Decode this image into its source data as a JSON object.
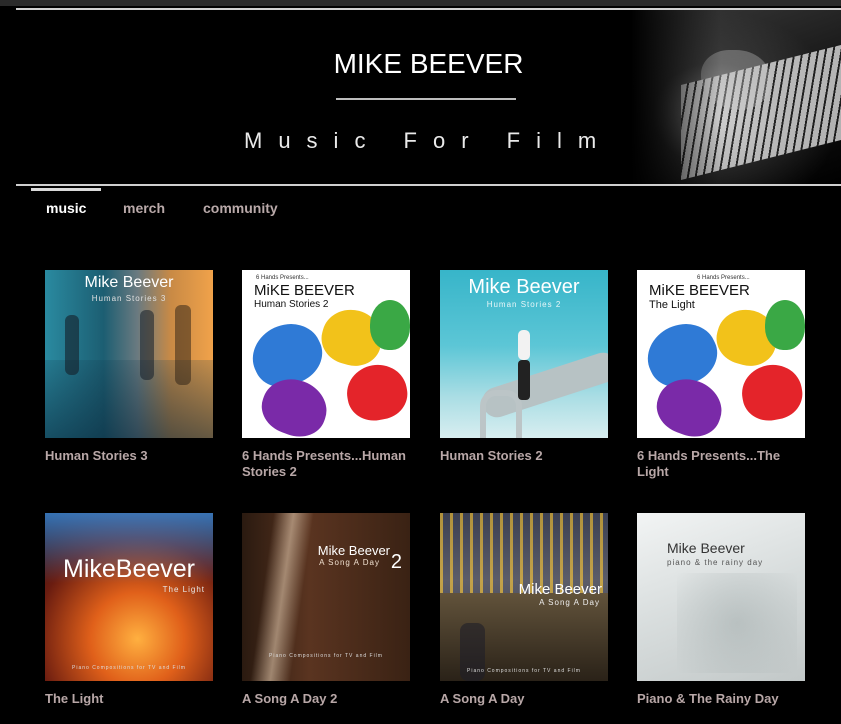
{
  "header": {
    "title": "MIKE BEEVER",
    "subtitle": "Music For Film"
  },
  "nav": {
    "tabs": [
      {
        "label": "music",
        "active": true
      },
      {
        "label": "merch",
        "active": false
      },
      {
        "label": "community",
        "active": false
      }
    ]
  },
  "albums": [
    {
      "title": "Human Stories 3",
      "cover": {
        "artist": "Mike Beever",
        "subtitle": "Human Stories 3",
        "presents": ""
      }
    },
    {
      "title": "6 Hands Presents...Human Stories 2",
      "cover": {
        "artist": "MiKE BEEVER",
        "subtitle": "Human Stories 2",
        "presents": "6 Hands Presents..."
      }
    },
    {
      "title": "Human Stories 2",
      "cover": {
        "artist": "Mike Beever",
        "subtitle": "Human Stories 2",
        "presents": ""
      }
    },
    {
      "title": "6 Hands Presents...The Light",
      "cover": {
        "artist": "MiKE BEEVER",
        "subtitle": "The Light",
        "presents": "6 Hands Presents..."
      }
    },
    {
      "title": "The Light",
      "cover": {
        "artist": "MikeBeever",
        "subtitle": "The Light",
        "footer": "Piano Compositions for TV and Film"
      }
    },
    {
      "title": "A Song A Day 2",
      "cover": {
        "artist": "Mike Beever",
        "subtitle": "A Song A Day",
        "number": "2",
        "footer": "Piano Compositions for TV and Film"
      }
    },
    {
      "title": "A Song A Day",
      "cover": {
        "artist": "Mike Beever",
        "subtitle": "A Song A Day",
        "footer": "Piano Compositions for TV and Film"
      }
    },
    {
      "title": "Piano & The Rainy Day",
      "cover": {
        "artist": "Mike Beever",
        "subtitle": "piano & the rainy day"
      }
    }
  ]
}
